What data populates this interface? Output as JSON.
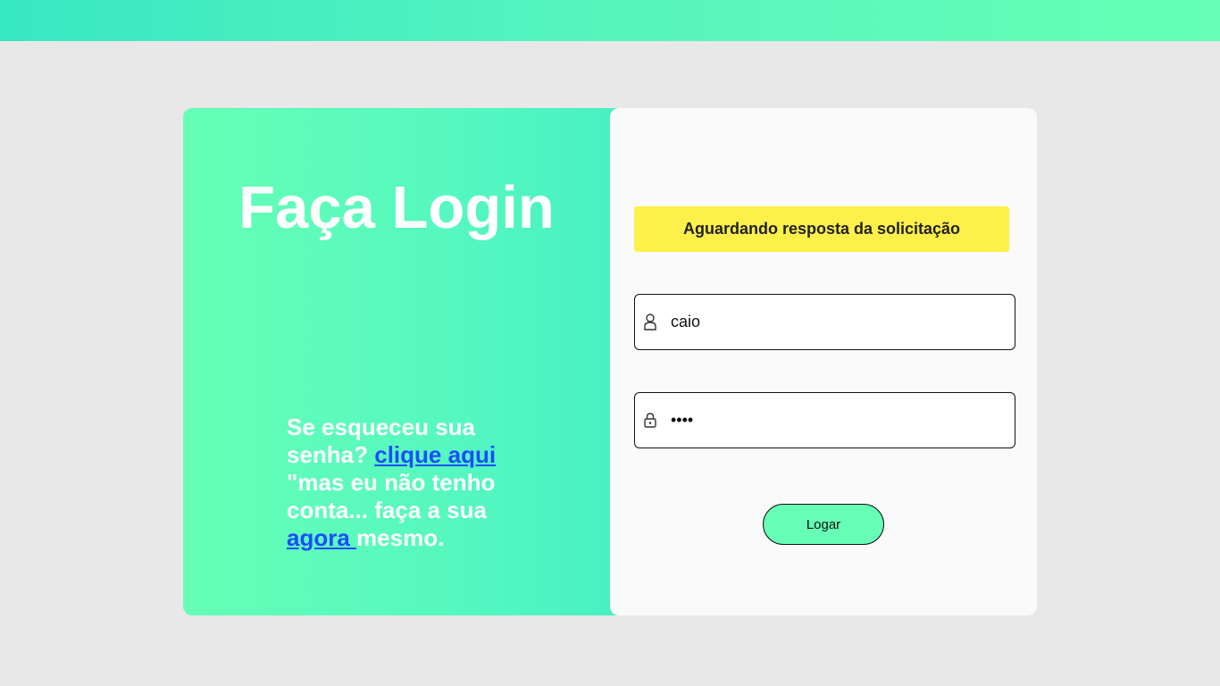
{
  "left_panel": {
    "title": "Faça Login",
    "help": {
      "line1": "Se esqueceu sua senha? ",
      "link1": "clique aqui",
      "line2": " \"mas eu não tenho conta... faça a sua ",
      "link2": "agora ",
      "line3": "mesmo."
    }
  },
  "right_panel": {
    "status_message": "Aguardando resposta da solicitação",
    "username": {
      "value": "caio",
      "icon": "user-icon"
    },
    "password": {
      "value": "••••",
      "icon": "lock-icon"
    },
    "login_button": "Logar"
  },
  "colors": {
    "accent": "#66ffb5",
    "teal": "#38e8c2",
    "status_yellow": "#fdf04a",
    "link_blue": "#1a4dff",
    "background": "#e8e8e8"
  }
}
